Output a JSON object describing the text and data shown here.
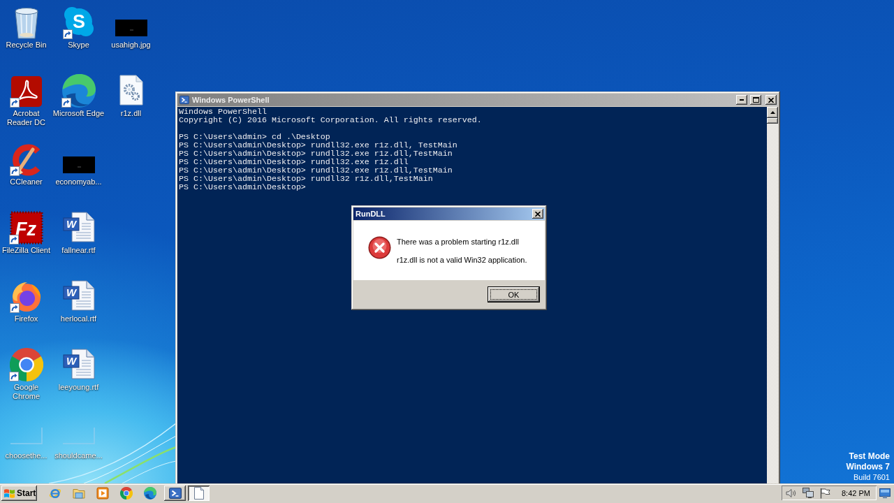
{
  "desktop": {
    "icons": [
      {
        "kind": "recycle-bin",
        "label": "Recycle Bin",
        "shortcut": false
      },
      {
        "kind": "acrobat",
        "label": "Acrobat Reader DC",
        "shortcut": true
      },
      {
        "kind": "ccleaner",
        "label": "CCleaner",
        "shortcut": true
      },
      {
        "kind": "filezilla",
        "label": "FileZilla Client",
        "shortcut": true,
        "logo_text": "Fz"
      },
      {
        "kind": "firefox",
        "label": "Firefox",
        "shortcut": true
      },
      {
        "kind": "chrome",
        "label": "Google Chrome",
        "shortcut": true
      },
      {
        "kind": "empty-thumbnail",
        "label": "choosethe...",
        "shortcut": false
      },
      {
        "kind": "skype",
        "label": "Skype",
        "shortcut": true,
        "logo_text": "S"
      },
      {
        "kind": "edge",
        "label": "Microsoft Edge",
        "shortcut": true
      },
      {
        "kind": "dark-thumbnail",
        "label": "economyab...",
        "shortcut": false
      },
      {
        "kind": "word-document",
        "label": "fallnear.rtf",
        "shortcut": false,
        "logo_text": "W"
      },
      {
        "kind": "word-document",
        "label": "herlocal.rtf",
        "shortcut": false,
        "logo_text": "W"
      },
      {
        "kind": "word-document",
        "label": "leeyoung.rtf",
        "shortcut": false,
        "logo_text": "W"
      },
      {
        "kind": "empty-thumbnail",
        "label": "shouldcame...",
        "shortcut": false
      },
      {
        "kind": "dark-thumbnail",
        "label": "usahigh.jpg",
        "shortcut": false
      },
      {
        "kind": "dll-file",
        "label": "r1z.dll",
        "shortcut": false
      }
    ],
    "os_info": [
      {
        "kind": "heading",
        "text": "Test Mode"
      },
      {
        "kind": "heading",
        "text": "Windows 7"
      },
      {
        "kind": "detail",
        "text": "Build 7601"
      }
    ]
  },
  "powershell_window": {
    "title": "Windows PowerShell",
    "active": false,
    "console": {
      "paragraphs": [
        {
          "lines": [
            "Windows PowerShell",
            "Copyright (C) 2016 Microsoft Corporation. All rights reserved."
          ]
        },
        {
          "lines": [
            "PS C:\\Users\\admin> cd .\\Desktop",
            "PS C:\\Users\\admin\\Desktop> rundll32.exe r1z.dll, TestMain",
            "PS C:\\Users\\admin\\Desktop> rundll32.exe r1z.dll,TestMain",
            "PS C:\\Users\\admin\\Desktop> rundll32.exe r1z.dll",
            "PS C:\\Users\\admin\\Desktop> rundll32.exe r1z.dll,TestMain",
            "PS C:\\Users\\admin\\Desktop> rundll32 r1z.dll,TestMain",
            "PS C:\\Users\\admin\\Desktop>"
          ]
        }
      ]
    }
  },
  "dialog": {
    "title": "RunDLL",
    "active": true,
    "message": "There was a problem starting r1z.dll",
    "detail": "r1z.dll is not a valid Win32 application.",
    "buttons": [
      {
        "label": "OK",
        "default": true
      }
    ]
  },
  "taskbar": {
    "start_label": "Start",
    "quick_launch": [
      {
        "kind": "internet-explorer"
      },
      {
        "kind": "file-explorer"
      },
      {
        "kind": "media-player"
      },
      {
        "kind": "chrome"
      },
      {
        "kind": "edge"
      }
    ],
    "tasks": [
      {
        "kind": "powershell",
        "selected": false
      },
      {
        "kind": "document",
        "selected": true
      }
    ],
    "tray": {
      "icons": [
        {
          "kind": "volume"
        },
        {
          "kind": "network"
        },
        {
          "kind": "flag"
        }
      ],
      "clock": "8:42 PM"
    }
  }
}
